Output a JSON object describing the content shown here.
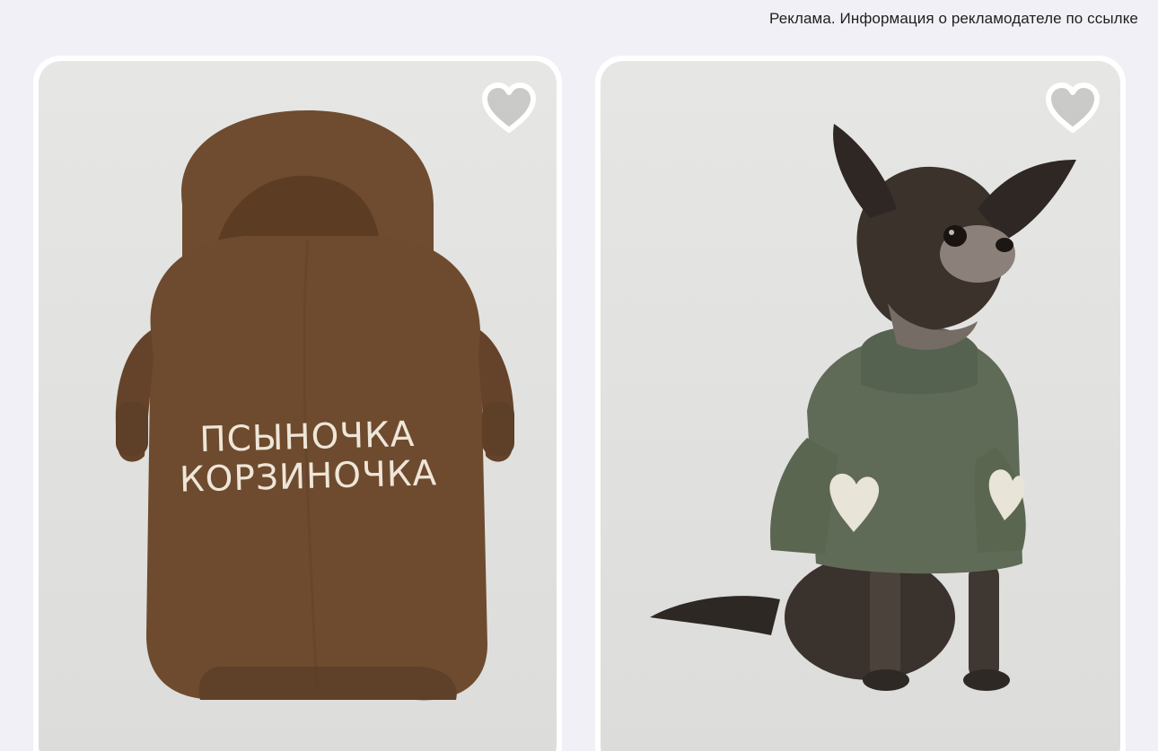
{
  "ad_notice": "Реклама. Информация о рекламодателе по ссылке",
  "cards": [
    {
      "product": "hoodie",
      "print_line1": "ПСЫНОЧКА",
      "print_line2": "КОРЗИНОЧКА",
      "favorite_icon": "heart-outline-icon"
    },
    {
      "product": "dog-sweater",
      "favorite_icon": "heart-outline-icon"
    }
  ],
  "colors": {
    "background": "#f0f0f6",
    "card": "#ffffff",
    "hoodie": "#6e4b2e",
    "sweater": "#5f6b57",
    "heart_patch": "#e9e4d8"
  }
}
